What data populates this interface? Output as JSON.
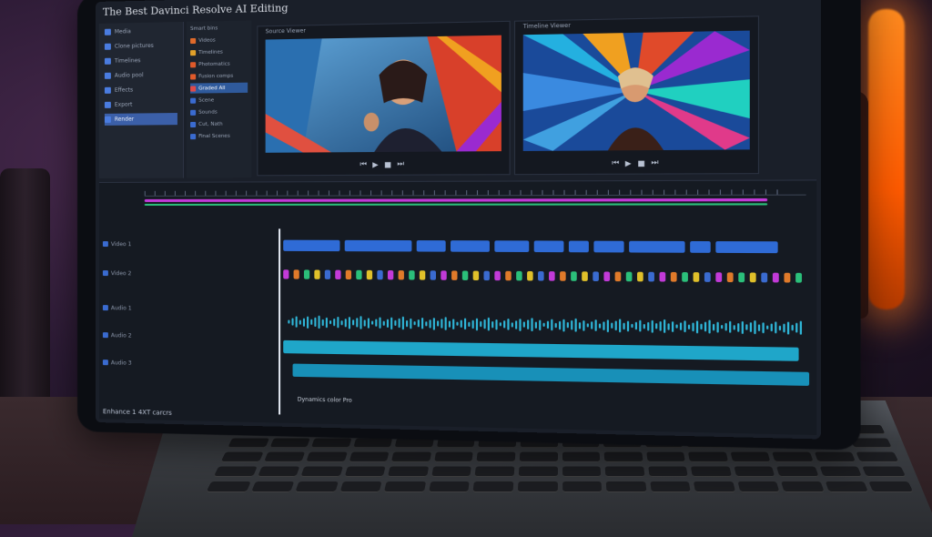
{
  "app": {
    "title": "The Best Davinci Resolve AI Editing",
    "status_text": "Enhance 1 4XT carcrs",
    "effect_label": "Dynamics color Pro"
  },
  "sidebar": {
    "items": [
      {
        "label": "Media",
        "icon": "folder-icon"
      },
      {
        "label": "Clone pictures",
        "icon": "clip-icon"
      },
      {
        "label": "Timelines",
        "icon": "timeline-icon"
      },
      {
        "label": "Audio pool",
        "icon": "audio-icon"
      },
      {
        "label": "Effects",
        "icon": "fx-icon"
      },
      {
        "label": "Export",
        "icon": "export-icon"
      },
      {
        "label": "Render",
        "icon": "render-icon",
        "active": true
      }
    ]
  },
  "bins": {
    "header": "Smart bins",
    "items": [
      {
        "label": "Videos",
        "color": "#e06a2a"
      },
      {
        "label": "Timelines",
        "color": "#e0a02a"
      },
      {
        "label": "Photomatics",
        "color": "#e05a2a"
      },
      {
        "label": "Fusion comps",
        "color": "#e05a2a"
      },
      {
        "label": "Graded All",
        "color": "#e04a4a",
        "active": true
      },
      {
        "label": "Scene",
        "color": "#3a6bd0"
      },
      {
        "label": "Sounds",
        "color": "#3a6bd0"
      },
      {
        "label": "Cut, Nath",
        "color": "#3a6bd0"
      },
      {
        "label": "Final Scenes",
        "color": "#3a6bd0"
      }
    ]
  },
  "viewers": {
    "source_label": "Source Viewer",
    "timeline_label": "Timeline Viewer"
  },
  "timeline": {
    "tracks": [
      {
        "label": "Video 1"
      },
      {
        "label": "Video 2"
      },
      {
        "label": "Audio 1"
      },
      {
        "label": "Audio 2"
      },
      {
        "label": "Audio 3"
      }
    ]
  },
  "colors": {
    "accent": "#3b6fd8",
    "clip_blue": "#2f6bd6",
    "clip_cyan": "#1fa6c9",
    "track_magenta": "#c23ad8",
    "track_green": "#2bbf7a",
    "glow_orange": "#ff7a1a"
  }
}
